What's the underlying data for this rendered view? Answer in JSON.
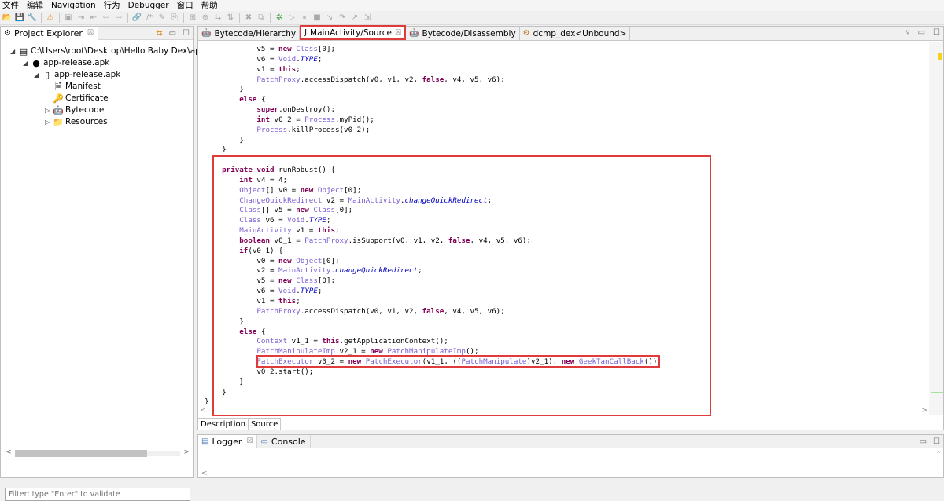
{
  "menubar": [
    "文件",
    "编辑",
    "Navigation",
    "行为",
    "Debugger",
    "窗口",
    "帮助"
  ],
  "toolbar_icons": [
    {
      "name": "open-icon",
      "glyph": "📂",
      "color": "orange"
    },
    {
      "name": "save-icon",
      "glyph": "💾",
      "color": "blue"
    },
    {
      "name": "wrench-icon",
      "glyph": "🔧",
      "color": "blue"
    },
    {
      "sep": true
    },
    {
      "name": "warning-icon",
      "glyph": "⚠",
      "color": "orange"
    },
    {
      "sep": true
    },
    {
      "name": "new-window-icon",
      "glyph": "▣",
      "color": "gray"
    },
    {
      "name": "navigate-in-icon",
      "glyph": "⇥",
      "color": "gray"
    },
    {
      "name": "navigate-out-icon",
      "glyph": "⇤",
      "color": "gray"
    },
    {
      "name": "back-icon",
      "glyph": "⇦",
      "color": "gray"
    },
    {
      "name": "forward-icon",
      "glyph": "⇨",
      "color": "gray"
    },
    {
      "sep": true
    },
    {
      "name": "link-icon",
      "glyph": "🔗",
      "color": "gray"
    },
    {
      "name": "comment-icon",
      "glyph": "/*",
      "color": "gray"
    },
    {
      "name": "rename-icon",
      "glyph": "✎",
      "color": "gray"
    },
    {
      "name": "export-icon",
      "glyph": "⎘",
      "color": "gray"
    },
    {
      "sep": true
    },
    {
      "name": "grid-icon",
      "glyph": "⊞",
      "color": "gray"
    },
    {
      "name": "hierarchy-icon",
      "glyph": "⊕",
      "color": "gray"
    },
    {
      "name": "xref-icon",
      "glyph": "⇆",
      "color": "gray"
    },
    {
      "name": "sort-icon",
      "glyph": "⇅",
      "color": "gray"
    },
    {
      "sep": true
    },
    {
      "name": "delete-icon",
      "glyph": "✖",
      "color": "gray"
    },
    {
      "name": "copy-icon",
      "glyph": "⧉",
      "color": "gray"
    },
    {
      "sep": true
    },
    {
      "name": "debug-icon",
      "glyph": "✲",
      "color": "green"
    },
    {
      "name": "run-icon",
      "glyph": "▷",
      "color": "gray"
    },
    {
      "name": "pause-icon",
      "glyph": "⏸",
      "color": "gray"
    },
    {
      "name": "stop-icon",
      "glyph": "■",
      "color": "gray"
    },
    {
      "name": "step-into-icon",
      "glyph": "↘",
      "color": "gray"
    },
    {
      "name": "step-over-icon",
      "glyph": "↷",
      "color": "gray"
    },
    {
      "name": "step-out-icon",
      "glyph": "↗",
      "color": "gray"
    },
    {
      "name": "run-to-icon",
      "glyph": "⇲",
      "color": "gray"
    }
  ],
  "explorer": {
    "tab_label": "Project Explorer",
    "close_glyph": "☒",
    "filter_placeholder": "Filter: type \"Enter\" to validate",
    "tree": [
      {
        "label": "C:\\Users\\root\\Desktop\\Hello Baby Dex\\app-re",
        "icon": "▤",
        "twisty": "◢",
        "depth": 0,
        "name": "tree-project-root"
      },
      {
        "label": "app-release.apk",
        "icon": "●",
        "twisty": "◢",
        "depth": 1,
        "name": "tree-apk-artifact"
      },
      {
        "label": "app-release.apk",
        "icon": "▯",
        "twisty": "◢",
        "depth": 2,
        "name": "tree-apk-unit"
      },
      {
        "label": "Manifest",
        "icon": "🗎",
        "twisty": "",
        "depth": 3,
        "name": "tree-manifest"
      },
      {
        "label": "Certificate",
        "icon": "🔑",
        "twisty": "",
        "depth": 3,
        "name": "tree-certificate"
      },
      {
        "label": "Bytecode",
        "icon": "🤖",
        "twisty": "▷",
        "depth": 3,
        "name": "tree-bytecode"
      },
      {
        "label": "Resources",
        "icon": "📁",
        "twisty": "▷",
        "depth": 3,
        "name": "tree-resources"
      }
    ]
  },
  "editor": {
    "tabs": [
      {
        "label": "Bytecode/Hierarchy",
        "icon": "🤖",
        "active": false,
        "closable": false
      },
      {
        "label": "MainActivity/Source",
        "icon": "J",
        "active": true,
        "closable": true
      },
      {
        "label": "Bytecode/Disassembly",
        "icon": "🤖",
        "active": false,
        "closable": false
      },
      {
        "label": "dcmp_dex<Unbound>",
        "icon": "⚙",
        "active": false,
        "closable": false
      }
    ],
    "bottom_tabs": [
      "Description",
      "Source"
    ],
    "code_lines": [
      "            v5 = new Class[0];",
      "            v6 = Void.TYPE;",
      "            v1 = this;",
      "            PatchProxy.accessDispatch(v0, v1, v2, false, v4, v5, v6);",
      "        }",
      "        else {",
      "            super.onDestroy();",
      "            int v0_2 = Process.myPid();",
      "            Process.killProcess(v0_2);",
      "        }",
      "    }",
      "",
      "    private void runRobust() {",
      "        int v4 = 4;",
      "        Object[] v0 = new Object[0];",
      "        ChangeQuickRedirect v2 = MainActivity.changeQuickRedirect;",
      "        Class[] v5 = new Class[0];",
      "        Class v6 = Void.TYPE;",
      "        MainActivity v1 = this;",
      "        boolean v0_1 = PatchProxy.isSupport(v0, v1, v2, false, v4, v5, v6);",
      "        if(v0_1) {",
      "            v0 = new Object[0];",
      "            v2 = MainActivity.changeQuickRedirect;",
      "            v5 = new Class[0];",
      "            v6 = Void.TYPE;",
      "            v1 = this;",
      "            PatchProxy.accessDispatch(v0, v1, v2, false, v4, v5, v6);",
      "        }",
      "        else {",
      "            Context v1_1 = this.getApplicationContext();",
      "            PatchManipulateImp v2_1 = new PatchManipulateImp();",
      "            PatchExecutor v0_2 = new PatchExecutor(v1_1, ((PatchManipulate)v2_1), new GeekTanCallBack());",
      "            v0_2.start();",
      "        }",
      "    }",
      "}"
    ]
  },
  "logger": {
    "tabs": [
      {
        "label": "Logger",
        "icon": "▤",
        "closable": true
      },
      {
        "label": "Console",
        "icon": "▭",
        "closable": false
      }
    ]
  },
  "colors": {
    "highlight_box": "#e03b3b",
    "keyword": "#7f0055",
    "type": "#7a5cd0",
    "static_field": "#0000c0"
  }
}
